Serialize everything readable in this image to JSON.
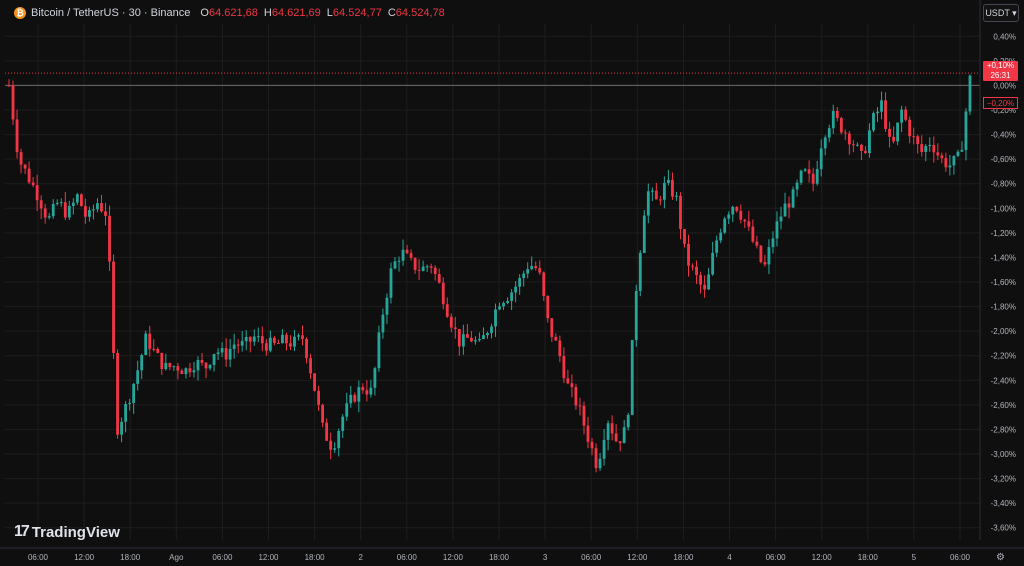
{
  "header": {
    "symbol": "Bitcoin / TetherUS · 30 · Binance",
    "coin_icon": "bitcoin-icon",
    "open_key": "O",
    "open": "64.621,68",
    "high_key": "H",
    "high": "64.621,69",
    "low_key": "L",
    "low": "64.524,77",
    "close_key": "C",
    "close": "64.524,78"
  },
  "currency_button": "USDT",
  "current_price_tag": {
    "change": "+0,10%",
    "countdown": "26:31"
  },
  "low_tag": "−0,20%",
  "logo": "TradingView",
  "colors": {
    "up": "#26a69a",
    "down": "#f23645",
    "background": "#0f0f0f",
    "grid": "#1e1e1e",
    "text": "#b2b5be"
  },
  "chart_data": {
    "type": "candlestick",
    "y_unit": "percent",
    "ylim": [
      -3.7,
      0.5
    ],
    "y_ticks": [
      "0,40%",
      "0,20%",
      "0,00%",
      "-0,20%",
      "-0,40%",
      "-0,60%",
      "-0,80%",
      "-1,00%",
      "-1,20%",
      "-1,40%",
      "-1,60%",
      "-1,80%",
      "-2,00%",
      "-2,20%",
      "-2,40%",
      "-2,60%",
      "-2,80%",
      "-3,00%",
      "-3,20%",
      "-3,40%",
      "-3,60%"
    ],
    "y_tick_values": [
      0.4,
      0.2,
      0.0,
      -0.2,
      -0.4,
      -0.6,
      -0.8,
      -1.0,
      -1.2,
      -1.4,
      -1.6,
      -1.8,
      -2.0,
      -2.2,
      -2.4,
      -2.6,
      -2.8,
      -3.0,
      -3.2,
      -3.4,
      -3.6
    ],
    "x_ticks": [
      "06:00",
      "12:00",
      "18:00",
      "Ago",
      "06:00",
      "12:00",
      "18:00",
      "2",
      "06:00",
      "12:00",
      "18:00",
      "3",
      "06:00",
      "12:00",
      "18:00",
      "4",
      "06:00",
      "12:00",
      "18:00",
      "5",
      "06:00"
    ],
    "reference_level": 0.0,
    "close_path": [
      [
        0,
        0.0
      ],
      [
        1,
        -0.6
      ],
      [
        2,
        -0.75
      ],
      [
        3,
        -0.9
      ],
      [
        4,
        -1.1
      ],
      [
        5,
        -0.95
      ],
      [
        6,
        -1.05
      ],
      [
        7,
        -0.9
      ],
      [
        8,
        -1.1
      ],
      [
        9,
        -0.95
      ],
      [
        10,
        -1.05
      ],
      [
        11,
        -2.8
      ],
      [
        12,
        -2.6
      ],
      [
        13,
        -2.35
      ],
      [
        14,
        -2.05
      ],
      [
        15,
        -2.2
      ],
      [
        16,
        -2.3
      ],
      [
        17,
        -2.28
      ],
      [
        18,
        -2.32
      ],
      [
        19,
        -2.25
      ],
      [
        20,
        -2.3
      ],
      [
        21,
        -2.15
      ],
      [
        22,
        -2.2
      ],
      [
        23,
        -2.1
      ],
      [
        24,
        -2.12
      ],
      [
        25,
        -2.05
      ],
      [
        26,
        -2.1
      ],
      [
        27,
        -2.12
      ],
      [
        28,
        -2.08
      ],
      [
        29,
        -2.1
      ],
      [
        30,
        -2.05
      ],
      [
        31,
        -2.4
      ],
      [
        32,
        -2.8
      ],
      [
        33,
        -2.95
      ],
      [
        34,
        -2.7
      ],
      [
        35,
        -2.55
      ],
      [
        36,
        -2.45
      ],
      [
        37,
        -2.5
      ],
      [
        38,
        -1.9
      ],
      [
        39,
        -1.5
      ],
      [
        40,
        -1.35
      ],
      [
        41,
        -1.45
      ],
      [
        42,
        -1.5
      ],
      [
        43,
        -1.45
      ],
      [
        44,
        -1.65
      ],
      [
        45,
        -1.9
      ],
      [
        46,
        -2.1
      ],
      [
        47,
        -2.05
      ],
      [
        48,
        -2.12
      ],
      [
        49,
        -1.95
      ],
      [
        50,
        -1.75
      ],
      [
        51,
        -1.7
      ],
      [
        52,
        -1.6
      ],
      [
        53,
        -1.45
      ],
      [
        54,
        -1.5
      ],
      [
        55,
        -1.95
      ],
      [
        56,
        -2.15
      ],
      [
        57,
        -2.45
      ],
      [
        58,
        -2.6
      ],
      [
        59,
        -2.85
      ],
      [
        60,
        -3.1
      ],
      [
        61,
        -2.7
      ],
      [
        62,
        -2.9
      ],
      [
        63,
        -2.8
      ],
      [
        64,
        -1.6
      ],
      [
        65,
        -0.85
      ],
      [
        66,
        -0.95
      ],
      [
        67,
        -0.8
      ],
      [
        68,
        -0.9
      ],
      [
        69,
        -1.4
      ],
      [
        70,
        -1.55
      ],
      [
        71,
        -1.7
      ],
      [
        72,
        -1.3
      ],
      [
        73,
        -1.05
      ],
      [
        74,
        -0.95
      ],
      [
        75,
        -1.1
      ],
      [
        76,
        -1.3
      ],
      [
        77,
        -1.5
      ],
      [
        78,
        -1.2
      ],
      [
        79,
        -1.0
      ],
      [
        80,
        -0.9
      ],
      [
        81,
        -0.7
      ],
      [
        82,
        -0.8
      ],
      [
        83,
        -0.4
      ],
      [
        84,
        -0.25
      ],
      [
        85,
        -0.35
      ],
      [
        86,
        -0.45
      ],
      [
        87,
        -0.6
      ],
      [
        88,
        -0.3
      ],
      [
        89,
        -0.15
      ],
      [
        90,
        -0.55
      ],
      [
        91,
        -0.2
      ],
      [
        92,
        -0.4
      ],
      [
        93,
        -0.55
      ],
      [
        94,
        -0.45
      ],
      [
        95,
        -0.6
      ],
      [
        96,
        -0.65
      ],
      [
        97,
        -0.58
      ],
      [
        98,
        0.05
      ]
    ]
  }
}
